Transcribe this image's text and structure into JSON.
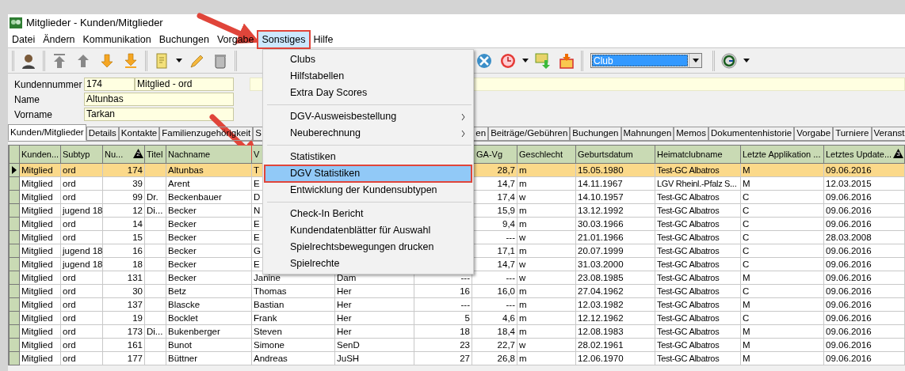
{
  "window": {
    "title": "Mitglieder - Kunden/Mitglieder"
  },
  "menubar": [
    {
      "label": "Datei",
      "selected": false,
      "annotated": false
    },
    {
      "label": "Ändern",
      "selected": false,
      "annotated": false
    },
    {
      "label": "Kommunikation",
      "selected": false,
      "annotated": false
    },
    {
      "label": "Buchungen",
      "selected": false,
      "annotated": false
    },
    {
      "label": "Vorgabe",
      "selected": false,
      "annotated": false
    },
    {
      "label": "Sonstiges",
      "selected": true,
      "annotated": true
    },
    {
      "label": "Hilfe",
      "selected": false,
      "annotated": false
    }
  ],
  "toolbar": {
    "combobox": {
      "value": "Club"
    }
  },
  "form": {
    "fields": [
      {
        "label": "Kundennummer",
        "values": [
          "174",
          "Mitglied - ord"
        ]
      },
      {
        "label": "Name",
        "values": [
          "Altunbas"
        ]
      },
      {
        "label": "Vorname",
        "values": [
          "Tarkan"
        ]
      }
    ]
  },
  "tabs": [
    {
      "label": "Kunden/Mitglieder",
      "selected": true,
      "kind": "tab"
    },
    {
      "label": "Details",
      "selected": false,
      "kind": "tab"
    },
    {
      "label": "Kontakte",
      "selected": false,
      "kind": "tab"
    },
    {
      "label": "Familienzugehörigkeit",
      "selected": false,
      "kind": "tab"
    },
    {
      "label": "S",
      "selected": false,
      "kind": "cut-right"
    },
    {
      "label": "en",
      "selected": false,
      "kind": "cut-left"
    },
    {
      "label": "Beiträge/Gebühren",
      "selected": false,
      "kind": "tab"
    },
    {
      "label": "Buchungen",
      "selected": false,
      "kind": "tab"
    },
    {
      "label": "Mahnungen",
      "selected": false,
      "kind": "tab"
    },
    {
      "label": "Memos",
      "selected": false,
      "kind": "tab"
    },
    {
      "label": "Dokumentenhistorie",
      "selected": false,
      "kind": "tab"
    },
    {
      "label": "Vorgabe",
      "selected": false,
      "kind": "tab"
    },
    {
      "label": "Turniere",
      "selected": false,
      "kind": "tab"
    },
    {
      "label": "Veranst",
      "selected": false,
      "kind": "cut-right"
    }
  ],
  "table": {
    "columns": [
      {
        "label": "Kunden..."
      },
      {
        "label": "Subtyp"
      },
      {
        "label": "Nu...",
        "sort_badge": "2"
      },
      {
        "label": "Titel"
      },
      {
        "label": "Nachname"
      },
      {
        "label": "V"
      },
      {},
      {},
      {
        "label": "GA-Vg"
      },
      {
        "label": "Geschlecht"
      },
      {
        "label": "Geburtsdatum"
      },
      {
        "label": "Heimatclubname"
      },
      {
        "label": "Letzte Applikation ..."
      },
      {
        "label": "Letztes Update...",
        "sort_badge": "3"
      }
    ],
    "rows": [
      {
        "selected": true,
        "cells": [
          "Mitglied",
          "ord",
          "174",
          null,
          "Altunbas",
          "T",
          null,
          null,
          "28,7",
          "m",
          "15.05.1980",
          "Test-GC Albatros",
          "M",
          "09.06.2016"
        ]
      },
      {
        "selected": false,
        "cells": [
          "Mitglied",
          "ord",
          "39",
          null,
          "Arent",
          "E",
          null,
          null,
          "14,7",
          "m",
          "14.11.1967",
          "LGV Rheinl.-Pfalz S...",
          "M",
          "12.03.2015"
        ]
      },
      {
        "selected": false,
        "cells": [
          "Mitglied",
          "ord",
          "99",
          "Dr.",
          "Beckenbauer",
          "D",
          null,
          null,
          "17,4",
          "w",
          "14.10.1957",
          "Test-GC Albatros",
          "C",
          "09.06.2016"
        ]
      },
      {
        "selected": false,
        "cells": [
          "Mitglied",
          "jugend 18",
          "12",
          "Di...",
          "Becker",
          "N",
          null,
          null,
          "15,9",
          "m",
          "13.12.1992",
          "Test-GC Albatros",
          "C",
          "09.06.2016"
        ]
      },
      {
        "selected": false,
        "cells": [
          "Mitglied",
          "ord",
          "14",
          null,
          "Becker",
          "E",
          null,
          null,
          "9,4",
          "m",
          "30.03.1966",
          "Test-GC Albatros",
          "C",
          "09.06.2016"
        ]
      },
      {
        "selected": false,
        "cells": [
          "Mitglied",
          "ord",
          "15",
          null,
          "Becker",
          "E",
          null,
          null,
          "---",
          "w",
          "21.01.1966",
          "Test-GC Albatros",
          "C",
          "28.03.2008"
        ]
      },
      {
        "selected": false,
        "cells": [
          "Mitglied",
          "jugend 18",
          "16",
          null,
          "Becker",
          "G",
          null,
          null,
          "17,1",
          "m",
          "20.07.1999",
          "Test-GC Albatros",
          "C",
          "09.06.2016"
        ]
      },
      {
        "selected": false,
        "cells": [
          "Mitglied",
          "jugend 18",
          "18",
          null,
          "Becker",
          "E",
          null,
          null,
          "14,7",
          "w",
          "31.03.2000",
          "Test-GC Albatros",
          "C",
          "09.06.2016"
        ]
      },
      {
        "selected": false,
        "cells": [
          "Mitglied",
          "ord",
          "131",
          null,
          "Becker",
          "Janine",
          "Dam",
          "---",
          "---",
          "w",
          "23.08.1985",
          "Test-GC Albatros",
          "M",
          "09.06.2016"
        ]
      },
      {
        "selected": false,
        "cells": [
          "Mitglied",
          "ord",
          "30",
          null,
          "Betz",
          "Thomas",
          "Her",
          "16",
          "16,0",
          "m",
          "27.04.1962",
          "Test-GC Albatros",
          "C",
          "09.06.2016"
        ]
      },
      {
        "selected": false,
        "cells": [
          "Mitglied",
          "ord",
          "137",
          null,
          "Blascke",
          "Bastian",
          "Her",
          "---",
          "---",
          "m",
          "12.03.1982",
          "Test-GC Albatros",
          "M",
          "09.06.2016"
        ]
      },
      {
        "selected": false,
        "cells": [
          "Mitglied",
          "ord",
          "19",
          null,
          "Bocklet",
          "Frank",
          "Her",
          "5",
          "4,6",
          "m",
          "12.12.1962",
          "Test-GC Albatros",
          "C",
          "09.06.2016"
        ]
      },
      {
        "selected": false,
        "cells": [
          "Mitglied",
          "ord",
          "173",
          "Di...",
          "Bukenberger",
          "Steven",
          "Her",
          "18",
          "18,4",
          "m",
          "12.08.1983",
          "Test-GC Albatros",
          "M",
          "09.06.2016"
        ]
      },
      {
        "selected": false,
        "cells": [
          "Mitglied",
          "ord",
          "161",
          null,
          "Bunot",
          "Simone",
          "SenD",
          "23",
          "22,7",
          "w",
          "28.02.1961",
          "Test-GC Albatros",
          "M",
          "09.06.2016"
        ]
      },
      {
        "selected": false,
        "cells": [
          "Mitglied",
          "ord",
          "177",
          null,
          "Büttner",
          "Andreas",
          "JuSH",
          "27",
          "26,8",
          "m",
          "12.06.1970",
          "Test-GC Albatros",
          "M",
          "09.06.2016"
        ]
      }
    ]
  },
  "menu": {
    "items": [
      {
        "kind": "item",
        "label": "Clubs",
        "selected": false,
        "annotated": false
      },
      {
        "kind": "item",
        "label": "Hilfstabellen",
        "selected": false,
        "annotated": false
      },
      {
        "kind": "item",
        "label": "Extra Day Scores",
        "selected": false,
        "annotated": false
      },
      {
        "kind": "separator"
      },
      {
        "kind": "submenu",
        "label": "DGV-Ausweisbestellung",
        "selected": false,
        "annotated": false
      },
      {
        "kind": "submenu",
        "label": "Neuberechnung",
        "selected": false,
        "annotated": false
      },
      {
        "kind": "separator"
      },
      {
        "kind": "item",
        "label": "Statistiken",
        "selected": false,
        "annotated": false
      },
      {
        "kind": "item",
        "label": "DGV Statistiken",
        "selected": true,
        "annotated": true
      },
      {
        "kind": "item",
        "label": "Entwicklung der Kundensubtypen",
        "selected": false,
        "annotated": false
      },
      {
        "kind": "separator"
      },
      {
        "kind": "item",
        "label": "Check-In Bericht",
        "selected": false,
        "annotated": false
      },
      {
        "kind": "item",
        "label": "Kundendatenblätter für Auswahl",
        "selected": false,
        "annotated": false
      },
      {
        "kind": "item",
        "label": "Spielrechtsbewegungen drucken",
        "selected": false,
        "annotated": false
      },
      {
        "kind": "item",
        "label": "Spielrechte",
        "selected": false,
        "annotated": false
      }
    ]
  }
}
